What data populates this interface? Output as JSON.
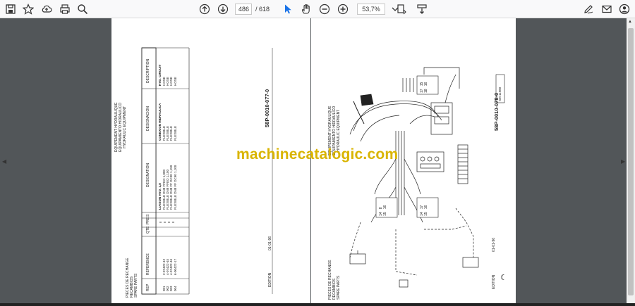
{
  "viewer": {
    "current_page": "486",
    "page_total": "/ 618",
    "zoom": "53,7%"
  },
  "left_page": {
    "header_lines": [
      "PIECES DE RECHANGE",
      "RECAMBIOS",
      "SPARE PARTS"
    ],
    "title_lines": [
      "EQUIPEMENT HYDRAULIQUE",
      "EQUIPAMIENTO HIDRAULICO",
      "HYDRAULIC EQUIPMENT"
    ],
    "table_headers": {
      "ref": "REP",
      "reference": "REFERENCE",
      "qty": "QTE",
      "pre": "PRE",
      "s": "S",
      "designation": "DESIGNATION",
      "designacion": "DESIGNACION",
      "description": "DESCRIPTION"
    },
    "section_fr": "LIAISON HYD. 1,8",
    "section_es": "CONEXION HIDRAULICA",
    "section_en": "HYD. CIRCUIT",
    "rows": [
      {
        "ref": "001",
        "reference": "2-07422-42",
        "fr": "FLEXIBLE DN8 FFEO 1,000",
        "es": "FLEXIBLE",
        "en": "HOSE"
      },
      {
        "ref": "002",
        "reference": "4-07422-45",
        "fr": "FLEXIBLE DN8 FFEO 1,150",
        "es": "FLEXIBLE",
        "en": "HOSE"
      },
      {
        "ref": "003",
        "reference": "4-07422-46",
        "fr": "FLEXIBLE DN8 FF DC90 1,150",
        "es": "FLEXIBLE",
        "en": "HOSE"
      },
      {
        "ref": "004",
        "reference": "6-00422-17",
        "fr": "FLEXIBLE DN8 FF DC90 1,100",
        "es": "FLEXIBLE",
        "en": "HOSE"
      }
    ],
    "edition": "EDITION",
    "date": "01-01-96",
    "code": "58P-0010-077-0"
  },
  "right_page": {
    "header_lines": [
      "PIECES DE RECHANGE",
      "RECAMBIOS",
      "SPARE PARTS"
    ],
    "title_lines": [
      "EQUIPEMENT HYDRAULIQUE",
      "EQUIPAMIENTO HIDRAULICO",
      "HYDRAULIC EQUIPMENT"
    ],
    "sm_ref": "SM 11980",
    "edition": "EDITION",
    "date": "01-01-96",
    "code": "58P-0010-078-0",
    "callouts_a": [
      "14",
      "8",
      "15",
      "16"
    ],
    "callouts_b": [
      "14",
      "17",
      "15",
      "16"
    ],
    "callouts_c": [
      "17",
      "15",
      "18",
      "16"
    ]
  },
  "watermark": "machinecatalogic.com"
}
